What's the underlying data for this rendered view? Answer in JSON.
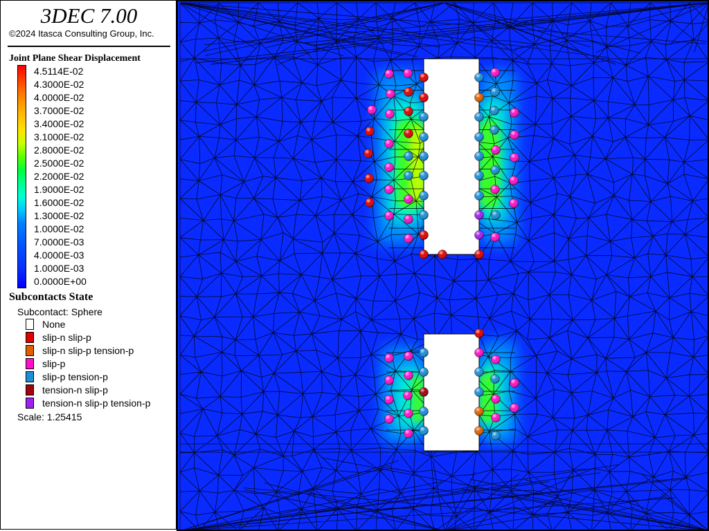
{
  "app": {
    "title": "3DEC 7.00",
    "copyright": "©2024 Itasca Consulting Group, Inc."
  },
  "legend": {
    "contour_title": "Joint Plane Shear Displacement",
    "contour_ticks": [
      "4.5114E-02",
      "4.3000E-02",
      "4.0000E-02",
      "3.7000E-02",
      "3.4000E-02",
      "3.1000E-02",
      "2.8000E-02",
      "2.5000E-02",
      "2.2000E-02",
      "1.9000E-02",
      "1.6000E-02",
      "1.3000E-02",
      "1.0000E-02",
      "7.0000E-03",
      "4.0000E-03",
      "1.0000E-03",
      "0.0000E+00"
    ],
    "state_title": "Subcontacts State",
    "state_subtitle": "Subcontact: Sphere",
    "states": [
      {
        "label": "None",
        "color": "#ffffff"
      },
      {
        "label": "slip-n slip-p",
        "color": "#e00000"
      },
      {
        "label": "slip-n slip-p tension-p",
        "color": "#e06000"
      },
      {
        "label": "slip-p",
        "color": "#ff10c8"
      },
      {
        "label": "slip-p tension-p",
        "color": "#1a8fd8"
      },
      {
        "label": "tension-n slip-p",
        "color": "#a00010"
      },
      {
        "label": "tension-n slip-p tension-p",
        "color": "#a020f0"
      }
    ],
    "scale": "Scale: 1.25415"
  },
  "colors": {
    "background": "#0a2bff",
    "mesh_line": "#000000",
    "excavation": "#ffffff"
  }
}
